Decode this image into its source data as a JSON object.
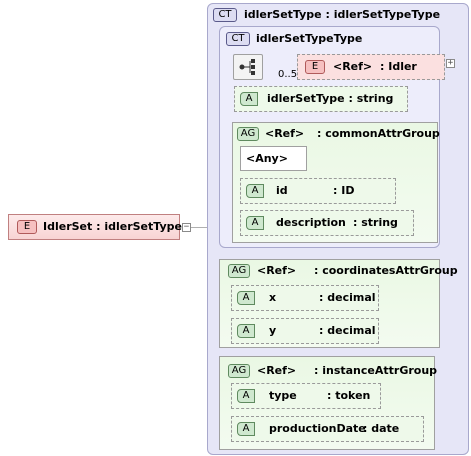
{
  "root_element": {
    "badge": "E",
    "label": "IdlerSet : idlerSetType"
  },
  "complex_type": {
    "badge": "CT",
    "label": "idlerSetType : idlerSetTypeType",
    "inner": {
      "badge": "CT",
      "label": "idlerSetTypeType",
      "sequence": {
        "multiplicity": "0..5"
      },
      "ref_element": {
        "badge": "E",
        "ref": "<Ref>",
        "label": ": Idler"
      },
      "attr_idlerSetType": {
        "badge": "A",
        "label": "idlerSetType : string"
      },
      "common_group": {
        "badge": "AG",
        "ref": "<Ref>",
        "label": ": commonAttrGroup",
        "any": "<Any>",
        "attrs": [
          {
            "badge": "A",
            "name": "id",
            "type": ": ID"
          },
          {
            "badge": "A",
            "name": "description",
            "type": ": string"
          }
        ]
      }
    },
    "coordinates_group": {
      "badge": "AG",
      "ref": "<Ref>",
      "label": ": coordinatesAttrGroup",
      "attrs": [
        {
          "badge": "A",
          "name": "x",
          "type": ": decimal"
        },
        {
          "badge": "A",
          "name": "y",
          "type": ": decimal"
        }
      ]
    },
    "instance_group": {
      "badge": "AG",
      "ref": "<Ref>",
      "label": ": instanceAttrGroup",
      "attrs": [
        {
          "badge": "A",
          "name": "type",
          "type": ": token"
        },
        {
          "badge": "A",
          "name": "productionDate",
          "type": ": date"
        }
      ]
    }
  },
  "colors": {
    "ct_fill": "#e8e8f8",
    "ct_border": "#9a9ac0",
    "ag_fill_top": "#e6f6e0",
    "element_fill": "#fbe0e0",
    "attr_fill": "#eef9ea"
  },
  "toggles": {
    "collapse": "−",
    "expand": "+"
  }
}
